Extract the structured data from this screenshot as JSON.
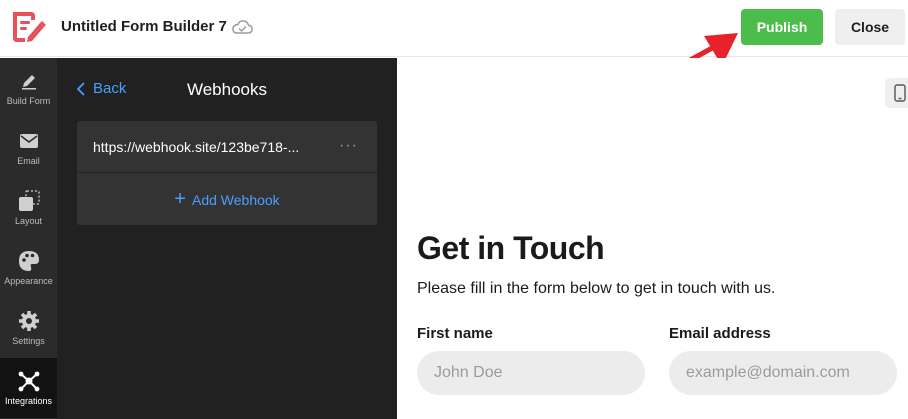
{
  "header": {
    "app_title": "Untitled Form Builder 7",
    "publish_label": "Publish",
    "close_label": "Close",
    "brand_color": "#e8505b",
    "publish_color": "#4cbd4a"
  },
  "rail": {
    "items": [
      {
        "label": "Build Form",
        "icon": "pencil-icon"
      },
      {
        "label": "Email",
        "icon": "envelope-icon"
      },
      {
        "label": "Layout",
        "icon": "layout-icon"
      },
      {
        "label": "Appearance",
        "icon": "palette-icon"
      },
      {
        "label": "Settings",
        "icon": "gear-icon"
      },
      {
        "label": "Integrations",
        "icon": "integrations-icon",
        "active": true
      }
    ]
  },
  "panel": {
    "back_label": "Back",
    "title": "Webhooks",
    "webhooks": [
      {
        "url": "https://webhook.site/123be718-..."
      }
    ],
    "add_label": "Add Webhook",
    "accent_color": "#4a9eff"
  },
  "preview": {
    "title": "Get in Touch",
    "description": "Please fill in the form below to get in touch with us.",
    "fields": [
      {
        "label": "First name",
        "placeholder": "John Doe"
      },
      {
        "label": "Email address",
        "placeholder": "example@domain.com"
      }
    ]
  }
}
